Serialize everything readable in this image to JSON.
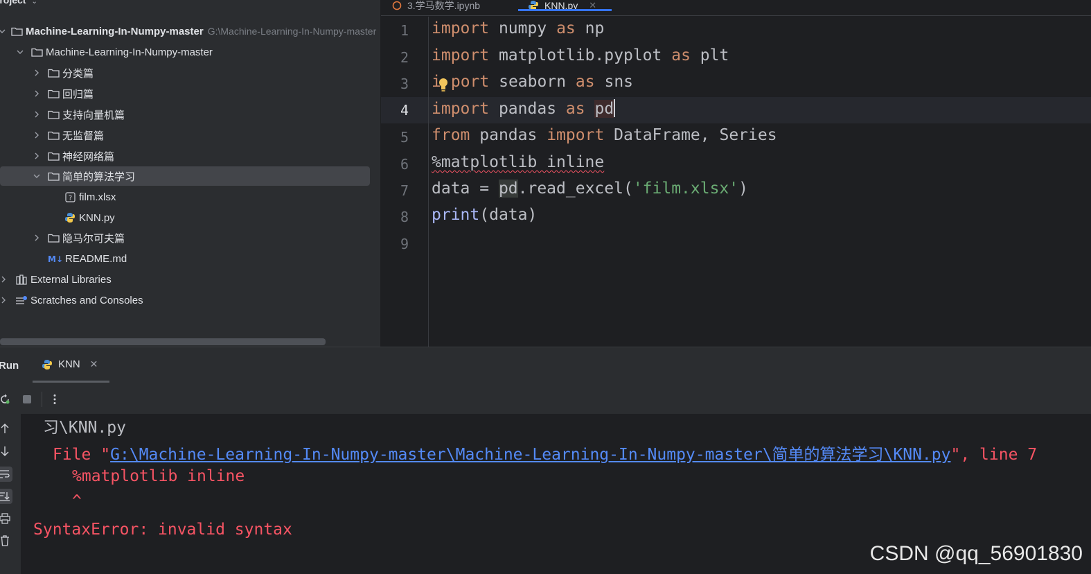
{
  "project": {
    "title": "Project",
    "tree": [
      {
        "label": "Machine-Learning-In-Numpy-master",
        "hint": "G:\\Machine-Learning-In-Numpy-master",
        "icon": "folder-icon"
      },
      {
        "label": "Machine-Learning-In-Numpy-master",
        "icon": "folder-icon"
      },
      {
        "label": "分类篇",
        "icon": "folder-icon"
      },
      {
        "label": "回归篇",
        "icon": "folder-icon"
      },
      {
        "label": "支持向量机篇",
        "icon": "folder-icon"
      },
      {
        "label": "无监督篇",
        "icon": "folder-icon"
      },
      {
        "label": "神经网络篇",
        "icon": "folder-icon"
      },
      {
        "label": "简单的算法学习",
        "icon": "folder-icon"
      },
      {
        "label": "film.xlsx",
        "icon": "unknown-file-icon"
      },
      {
        "label": "KNN.py",
        "icon": "python-file-icon"
      },
      {
        "label": "隐马尔可夫篇",
        "icon": "folder-icon"
      },
      {
        "label": "README.md",
        "icon": "markdown-file-icon"
      },
      {
        "label": "External Libraries",
        "icon": "library-icon"
      },
      {
        "label": "Scratches and Consoles",
        "icon": "scratches-icon"
      }
    ]
  },
  "editor": {
    "tabs": [
      {
        "label": "3.学马数学.ipynb",
        "active": false
      },
      {
        "label": "KNN.py",
        "active": true
      }
    ],
    "line_numbers": [
      "1",
      "2",
      "3",
      "4",
      "5",
      "6",
      "7",
      "8",
      "9"
    ],
    "current_line": "4",
    "tokens": {
      "import": "import",
      "as": "as",
      "from": "from",
      "l1_mod": "numpy",
      "l1_alias": "np",
      "l2_mod": "matplotlib.pyplot",
      "l2_alias": "plt",
      "l3_i": "i",
      "l3_rest": "port",
      "l3_mod": "seaborn",
      "l3_alias": "sns",
      "l4_mod": "pandas",
      "l4_alias": "pd",
      "l5_mod": "pandas",
      "l5_names": "DataFrame, Series",
      "l6_magic": "%matplotlib inline",
      "l7_lhs": "data = ",
      "l7_obj": "pd",
      "l7_call": ".read_excel(",
      "l7_str": "'film.xlsx'",
      "l7_close": ")",
      "l8_fn": "print",
      "l8_args": "(data)"
    }
  },
  "run": {
    "label": "Run",
    "tab_label": "KNN",
    "console": {
      "line1": "习\\KNN.py",
      "file_prefix": "File \"",
      "file_link": "G:\\Machine-Learning-In-Numpy-master\\Machine-Learning-In-Numpy-master\\简单的算法学习\\KNN.py",
      "file_suffix": "\", line 7",
      "code_line": "%matplotlib inline",
      "caret": "^",
      "error": "SyntaxError: invalid syntax"
    }
  },
  "watermark": "CSDN @qq_56901830",
  "colors": {
    "background": "#1e1f22",
    "panel": "#2b2d30",
    "keyword": "#cf8e6d",
    "string": "#6aab73",
    "builtin": "#a9b7f6",
    "error": "#f75464",
    "link": "#548af7",
    "accent": "#3574f0"
  }
}
